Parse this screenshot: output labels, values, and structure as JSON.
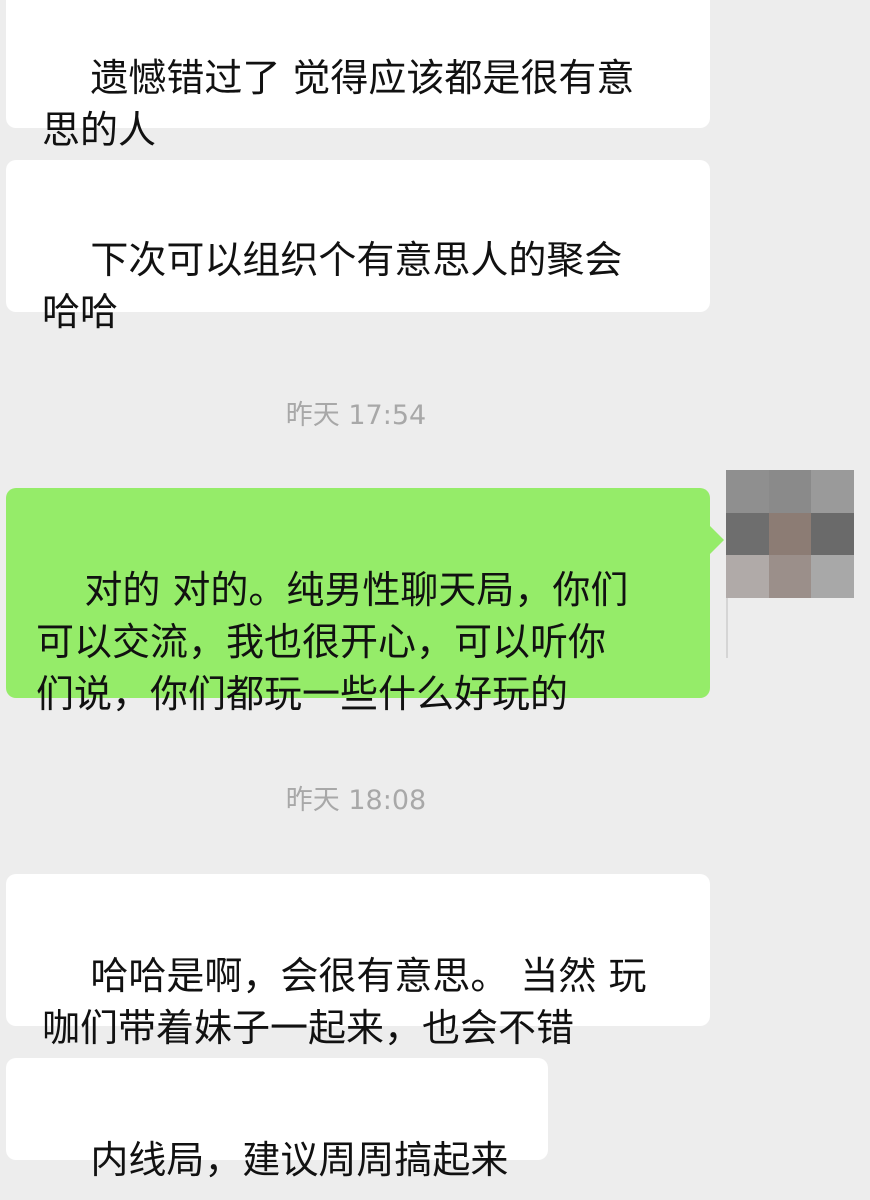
{
  "messages": [
    {
      "direction": "incoming",
      "text": "遗憾错过了 觉得应该都是很有意\n思的人"
    },
    {
      "direction": "incoming",
      "text": "下次可以组织个有意思人的聚会\n哈哈"
    },
    {
      "direction": "outgoing",
      "text": "对的 对的。纯男性聊天局，你们\n可以交流，我也很开心，可以听你\n们说，你们都玩一些什么好玩的"
    },
    {
      "direction": "incoming",
      "text": "哈哈是啊，会很有意思。 当然 玩\n咖们带着妹子一起来，也会不错"
    },
    {
      "direction": "incoming",
      "text": "内线局，建议周周搞起来"
    }
  ],
  "timestamps": [
    "昨天 17:54",
    "昨天 18:08"
  ],
  "colors": {
    "background": "#ededed",
    "incoming_bubble": "#ffffff",
    "outgoing_bubble": "#95ec69",
    "timestamp_text": "#a8a8a8"
  },
  "avatar": {
    "description": "pixelated-avatar",
    "pixels": [
      "#8f8f8f",
      "#8a8a8a",
      "#9a9a9a",
      "#6e6e6e",
      "#8c7c74",
      "#6a6a6a",
      "#b0aaa8",
      "#9b8f8a",
      "#a8a8a8"
    ]
  }
}
